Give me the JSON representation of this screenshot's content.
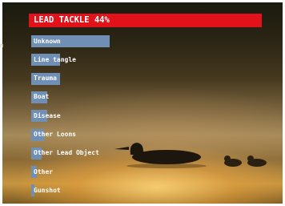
{
  "chart_data": {
    "type": "bar",
    "title": "LEAD TACKLE 44%",
    "categories": [
      "Unknown",
      "Line tangle",
      "Trauma",
      "Boat",
      "Disease",
      "Other Loons",
      "Other Lead Object",
      "Other",
      "Gunshot"
    ],
    "values": [
      44,
      16,
      16,
      9,
      9,
      7,
      6,
      3,
      2
    ],
    "xlim": [
      0,
      44
    ]
  },
  "stray_text": "m"
}
